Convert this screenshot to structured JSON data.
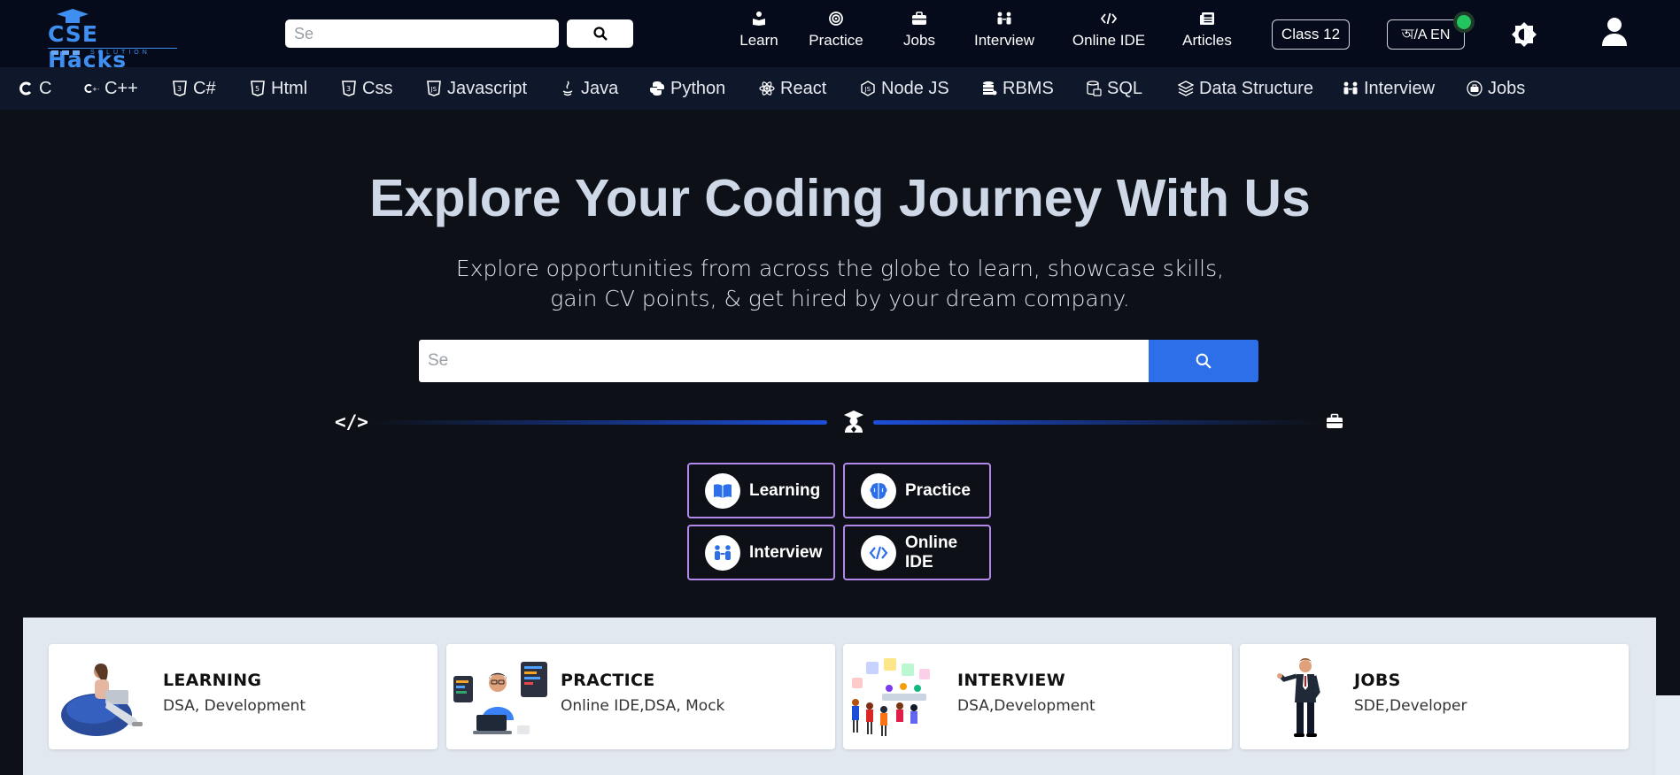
{
  "brand": {
    "name": "CSE Hacks",
    "tagline": "SOLUTION"
  },
  "top_search": {
    "placeholder": "Se"
  },
  "nav": [
    {
      "label": "Learn",
      "icon": "learn-icon"
    },
    {
      "label": "Practice",
      "icon": "target-icon"
    },
    {
      "label": "Jobs",
      "icon": "briefcase-icon"
    },
    {
      "label": "Interview",
      "icon": "people-icon"
    },
    {
      "label": "Online IDE",
      "icon": "code-icon"
    },
    {
      "label": "Articles",
      "icon": "newspaper-icon"
    }
  ],
  "class_button": "Class 12",
  "language_toggle": "অ/A  EN",
  "langs": [
    {
      "label": "C"
    },
    {
      "label": "C++"
    },
    {
      "label": "C#"
    },
    {
      "label": "Html"
    },
    {
      "label": "Css"
    },
    {
      "label": "Javascript"
    },
    {
      "label": "Java"
    },
    {
      "label": "Python"
    },
    {
      "label": "React"
    },
    {
      "label": "Node JS"
    },
    {
      "label": "RBMS"
    },
    {
      "label": "SQL"
    },
    {
      "label": "Data Structure"
    },
    {
      "label": "Interview"
    },
    {
      "label": "Jobs"
    }
  ],
  "hero": {
    "title": "Explore Your Coding Journey With Us",
    "subtitle_line1": "Explore opportunities from across the globe to learn, showcase skills,",
    "subtitle_line2": "gain CV points, & get hired by your dream company.",
    "search_placeholder": "Se",
    "track_code": "</>"
  },
  "ctas": [
    {
      "label": "Learning"
    },
    {
      "label": "Practice"
    },
    {
      "label": "Interview"
    },
    {
      "label": "Online IDE"
    }
  ],
  "cards": [
    {
      "title": "LEARNING",
      "desc": "DSA, Development"
    },
    {
      "title": "PRACTICE",
      "desc": "Online IDE,DSA, Mock"
    },
    {
      "title": "INTERVIEW",
      "desc": "DSA,Development"
    },
    {
      "title": "JOBS",
      "desc": "SDE,Developer"
    }
  ],
  "colors": {
    "accent": "#2c6fe8",
    "cta_border": "#b388eb",
    "status_dot": "#22c55e"
  }
}
